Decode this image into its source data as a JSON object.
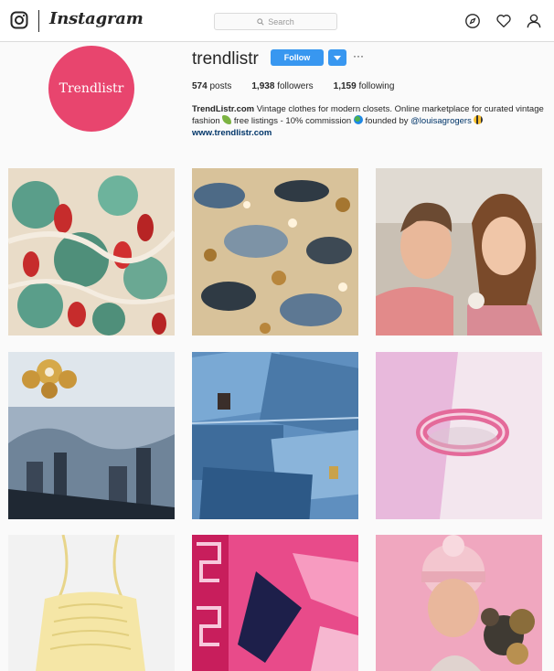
{
  "app": {
    "name": "Instagram"
  },
  "search": {
    "placeholder": "Search"
  },
  "profile": {
    "avatar_text": "Trendlistr",
    "username": "trendlistr",
    "follow_label": "Follow",
    "more_label": "···",
    "stats": [
      {
        "value": "574",
        "label": "posts"
      },
      {
        "value": "1,938",
        "label": "followers"
      },
      {
        "value": "1,159",
        "label": "following"
      }
    ],
    "bio": {
      "name": "TrendListr.com",
      "text1": " Vintage clothes for modern closets. Online marketplace for curated vintage fashion ",
      "text2": " free listings - 10% commission ",
      "text3": " founded by ",
      "mention": "@louisagrogers",
      "website": "www.trendlistr.com"
    }
  },
  "posts": [
    {
      "subject": "floral-fabric"
    },
    {
      "subject": "animal-print-fabric"
    },
    {
      "subject": "couple-selfie"
    },
    {
      "subject": "brooch-winter-city"
    },
    {
      "subject": "denim-shorts"
    },
    {
      "subject": "pink-bangle"
    },
    {
      "subject": "yellow-halter-top"
    },
    {
      "subject": "pink-scarf"
    },
    {
      "subject": "woman-pink-beanie"
    }
  ],
  "colors": {
    "accent": "#3897f0",
    "avatar": "#e8456e",
    "link": "#003569"
  }
}
